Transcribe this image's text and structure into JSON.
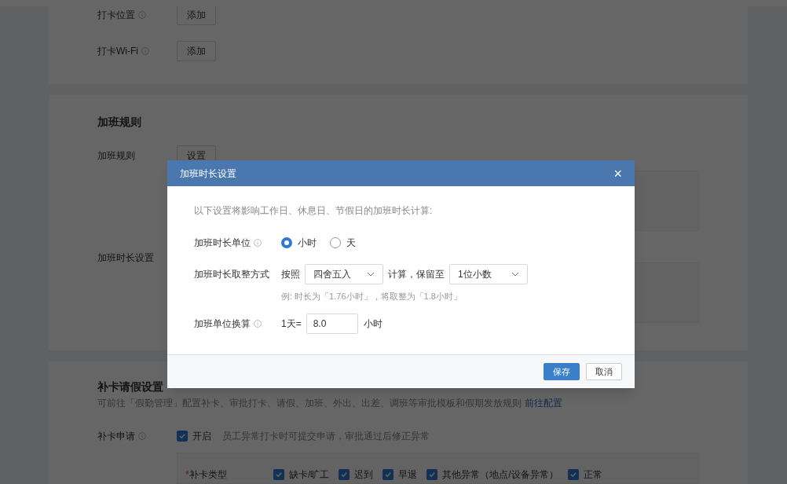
{
  "background": {
    "location_rows": [
      {
        "label": "打卡位置",
        "button": "添加"
      },
      {
        "label": "打卡Wi-Fi",
        "button": "添加"
      }
    ],
    "overtime": {
      "title": "加班规则",
      "rule_label": "加班规则",
      "rule_button": "设置",
      "duration_label": "加班时长设置"
    },
    "leave": {
      "title": "补卡请假设置",
      "description": "可前往「假勤管理」配置补卡、审批打卡、请假、加班、外出、出差、调班等审批模板和假期发放规则",
      "link": "前往配置",
      "apply_label": "补卡申请",
      "apply_checkbox": {
        "label": "开启",
        "checked": true
      },
      "apply_note": "员工异常打卡时可提交申请，审批通过后修正异常",
      "types_label": "补卡类型",
      "required_mark": "*",
      "types": [
        {
          "label": "缺卡/旷工",
          "checked": true
        },
        {
          "label": "迟到",
          "checked": true
        },
        {
          "label": "早退",
          "checked": true
        },
        {
          "label": "其他异常（地点/设备异常）",
          "checked": true
        },
        {
          "label": "正常",
          "checked": true
        }
      ]
    }
  },
  "dialog": {
    "title": "加班时长设置",
    "close": "×",
    "intro": "以下设置将影响工作日、休息日、节假日的加班时长计算:",
    "unit_label": "加班时长单位",
    "unit_options": [
      {
        "label": "小时",
        "selected": true
      },
      {
        "label": "天",
        "selected": false
      }
    ],
    "rounding_label": "加班时长取整方式",
    "rounding_prefix": "按照",
    "rounding_method": "四舍五入",
    "rounding_middle": "计算，保留至",
    "rounding_precision": "1位小数",
    "rounding_example": "例: 时长为「1.76小时」，将取整为「1.8小时」",
    "conversion_label": "加班单位换算",
    "conversion_prefix": "1天=",
    "conversion_value": "8.0",
    "conversion_suffix": "小时",
    "buttons": [
      {
        "label": "保存",
        "kind": "primary"
      },
      {
        "label": "取消",
        "kind": "secondary"
      }
    ]
  }
}
